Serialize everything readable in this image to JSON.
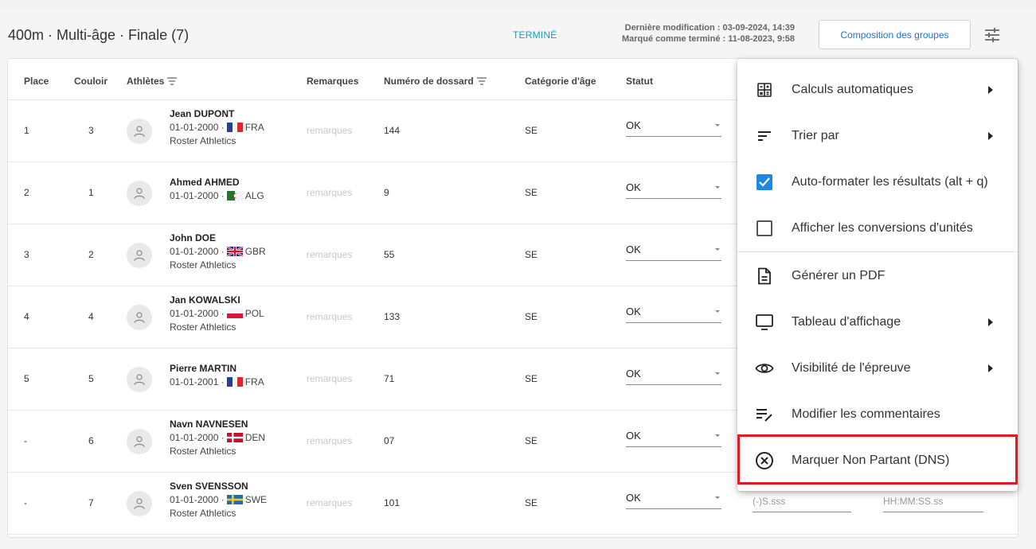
{
  "header": {
    "title": "400m · Multi-âge · Finale (7)",
    "status": "TERMINÉ",
    "last_modified": "Dernière modification : 03-09-2024, 14:39",
    "marked_finished": "Marqué comme terminé : 11-08-2023, 9:58",
    "groups_button": "Composition des groupes",
    "settings_icon": "tune-icon"
  },
  "table": {
    "columns": {
      "place": "Place",
      "lane": "Couloir",
      "athletes": "Athlètes",
      "remarks": "Remarques",
      "bib": "Numéro de dossard",
      "age_category": "Catégorie d'âge",
      "status": "Statut"
    },
    "remarks_placeholder": "remarques",
    "rows": [
      {
        "place": "1",
        "lane": "3",
        "name": "Jean DUPONT",
        "dob": "01-01-2000 ·",
        "country": "FRA",
        "flag": "fra",
        "club": "Roster Athletics",
        "bib": "144",
        "category": "SE",
        "status": "OK"
      },
      {
        "place": "2",
        "lane": "1",
        "name": "Ahmed AHMED",
        "dob": "01-01-2000 ·",
        "country": "ALG",
        "flag": "alg",
        "club": "",
        "bib": "9",
        "category": "SE",
        "status": "OK"
      },
      {
        "place": "3",
        "lane": "2",
        "name": "John DOE",
        "dob": "01-01-2000 ·",
        "country": "GBR",
        "flag": "gbr",
        "club": "Roster Athletics",
        "bib": "55",
        "category": "SE",
        "status": "OK"
      },
      {
        "place": "4",
        "lane": "4",
        "name": "Jan KOWALSKI",
        "dob": "01-01-2000 ·",
        "country": "POL",
        "flag": "pol",
        "club": "Roster Athletics",
        "bib": "133",
        "category": "SE",
        "status": "OK"
      },
      {
        "place": "5",
        "lane": "5",
        "name": "Pierre MARTIN",
        "dob": "01-01-2001 ·",
        "country": "FRA",
        "flag": "fra",
        "club": "",
        "bib": "71",
        "category": "SE",
        "status": "OK"
      },
      {
        "place": "-",
        "lane": "6",
        "name": "Navn NAVNESEN",
        "dob": "01-01-2000 ·",
        "country": "DEN",
        "flag": "den",
        "club": "Roster Athletics",
        "bib": "07",
        "category": "SE",
        "status": "OK"
      },
      {
        "place": "-",
        "lane": "7",
        "name": "Sven SVENSSON",
        "dob": "01-01-2000 ·",
        "country": "SWE",
        "flag": "swe",
        "club": "Roster Athletics",
        "bib": "101",
        "category": "SE",
        "status": "OK"
      }
    ],
    "last_row_result_placeholder": "(-)S.sss",
    "last_row_time_placeholder": "HH:MM:SS.ss"
  },
  "menu": {
    "items": [
      {
        "label": "Calculs automatiques",
        "icon": "calculator-icon",
        "submenu": true
      },
      {
        "label": "Trier par",
        "icon": "sort-icon",
        "submenu": true
      },
      {
        "label": "Auto-formater les résultats (alt + q)",
        "icon": "checkbox-checked-icon",
        "checked": true
      },
      {
        "label": "Afficher les conversions d'unités",
        "icon": "checkbox-empty-icon",
        "checked": false
      },
      {
        "label": "Générer un PDF",
        "icon": "document-icon"
      },
      {
        "label": "Tableau d'affichage",
        "icon": "monitor-icon",
        "submenu": true
      },
      {
        "label": "Visibilité de l'épreuve",
        "icon": "eye-icon",
        "submenu": true
      },
      {
        "label": "Modifier les commentaires",
        "icon": "edit-notes-icon"
      },
      {
        "label": "Marquer Non Partant (DNS)",
        "icon": "circle-x-icon",
        "highlighted": true
      }
    ]
  },
  "colors": {
    "accent": "#1976d2",
    "status_teal": "#17a2b8",
    "highlight_red": "#e01b24",
    "checkbox_blue": "#1e88e5"
  }
}
